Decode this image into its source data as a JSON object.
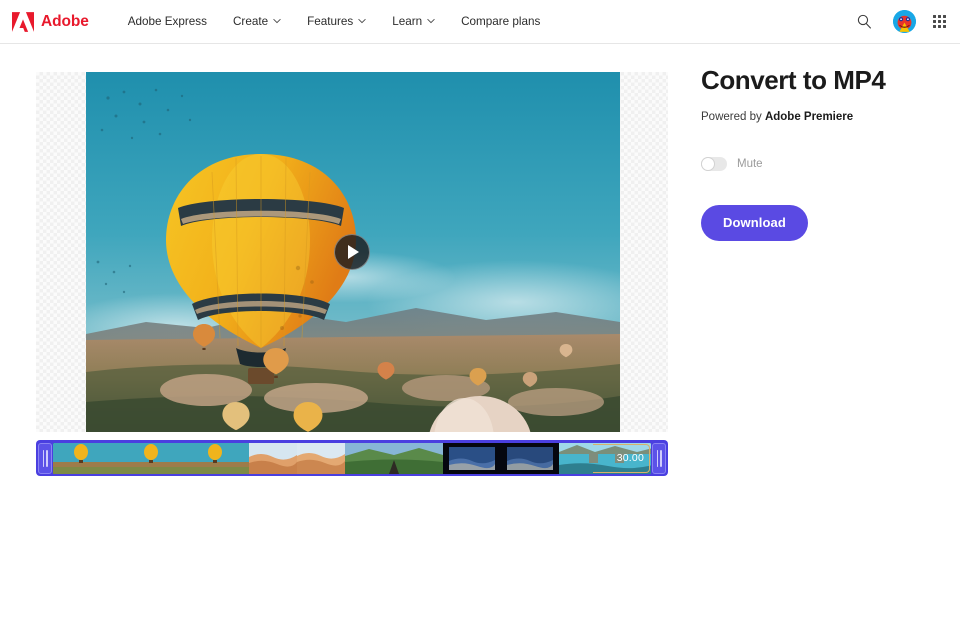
{
  "header": {
    "brand": {
      "logo_icon": "adobe-logo-icon",
      "name": "Adobe",
      "logo_color": "#e8192c"
    },
    "nav": [
      {
        "label": "Adobe Express",
        "has_dropdown": false
      },
      {
        "label": "Create",
        "has_dropdown": true
      },
      {
        "label": "Features",
        "has_dropdown": true
      },
      {
        "label": "Learn",
        "has_dropdown": true
      },
      {
        "label": "Compare plans",
        "has_dropdown": false
      }
    ],
    "actions": {
      "search_icon": "search-icon",
      "avatar_icon": "user-avatar",
      "app_grid_icon": "app-grid-icon"
    }
  },
  "stage": {
    "play_icon": "play-icon",
    "media_description": "Hot air balloon over Cappadocia landscape",
    "background": "transparent-checkerboard"
  },
  "timeline": {
    "left_handle_icon": "trim-handle-left",
    "right_handle_icon": "trim-handle-right",
    "duration_label": "30.00",
    "accent_color": "#4a3fe0",
    "thumbnail_count": 9
  },
  "panel": {
    "title": "Convert to MP4",
    "powered_prefix": "Powered by ",
    "powered_brand": "Adobe Premiere",
    "mute": {
      "label": "Mute",
      "enabled": false
    },
    "download_label": "Download",
    "download_color": "#5a4ae3"
  }
}
